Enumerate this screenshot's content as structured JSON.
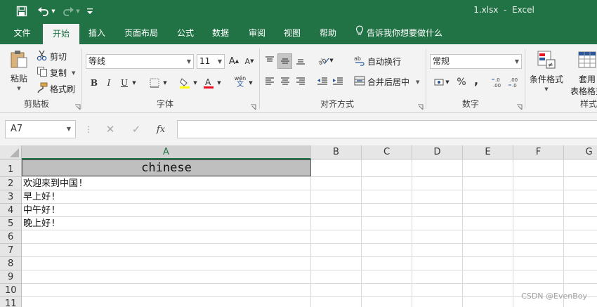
{
  "window": {
    "title": "1.xlsx  -  Excel"
  },
  "tabs": [
    {
      "label": "文件",
      "active": false
    },
    {
      "label": "开始",
      "active": true
    },
    {
      "label": "插入",
      "active": false
    },
    {
      "label": "页面布局",
      "active": false
    },
    {
      "label": "公式",
      "active": false
    },
    {
      "label": "数据",
      "active": false
    },
    {
      "label": "审阅",
      "active": false
    },
    {
      "label": "视图",
      "active": false
    },
    {
      "label": "帮助",
      "active": false
    }
  ],
  "tell_me": "告诉我你想要做什么",
  "clipboard": {
    "paste": "粘贴",
    "cut": "剪切",
    "copy": "复制",
    "format_painter": "格式刷",
    "group": "剪贴板"
  },
  "font": {
    "name": "等线",
    "size": "11",
    "group": "字体",
    "wen": "wén",
    "wen_char": "文"
  },
  "alignment": {
    "wrap_text": "自动换行",
    "merge_center": "合并后居中",
    "group": "对齐方式"
  },
  "number": {
    "format": "常规",
    "group": "数字",
    "percent": "%",
    "comma": ","
  },
  "styles": {
    "conditional": "条件格式",
    "table_line1": "套用",
    "table_line2": "表格格式",
    "group": "样式"
  },
  "formula": {
    "name_box": "A7",
    "value": ""
  },
  "columns": [
    "A",
    "B",
    "C",
    "D",
    "E",
    "F",
    "G"
  ],
  "rows": [
    "1",
    "2",
    "3",
    "4",
    "5",
    "6",
    "7",
    "8",
    "9",
    "10",
    "11"
  ],
  "cells": {
    "A1": "chinese",
    "A2": "欢迎来到中国!",
    "A3": "早上好!",
    "A4": "中午好!",
    "A5": "晚上好!"
  },
  "watermark": "CSDN @EvenBoy",
  "colors": {
    "accent": "#217346",
    "ribbon_bg": "#f3f3f3",
    "header_fill": "#bfbfbf"
  }
}
